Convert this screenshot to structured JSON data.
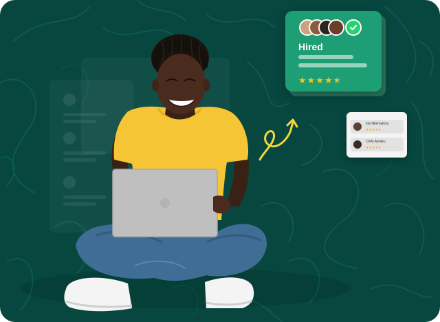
{
  "colors": {
    "background": "#07473f",
    "card": "#1e9e74",
    "check": "#27d16f",
    "star": "#f5c518",
    "arrow": "#f3d83a",
    "shirt": "#f5c535",
    "jeans": "#3f6d94"
  },
  "hired_card": {
    "title": "Hired",
    "avatar_count": 4,
    "rating": 4.5,
    "icons": [
      "avatar-group",
      "check-icon",
      "star-icon"
    ]
  },
  "candidates_card": {
    "rows": [
      {
        "name": "Ida Nkemakolu",
        "rating": 5
      },
      {
        "name": "Chifu Apraku",
        "rating": 5
      }
    ]
  },
  "decor": {
    "arrow_icon": "curly-arrow-up-icon",
    "background_pattern": "topographic-lines"
  }
}
